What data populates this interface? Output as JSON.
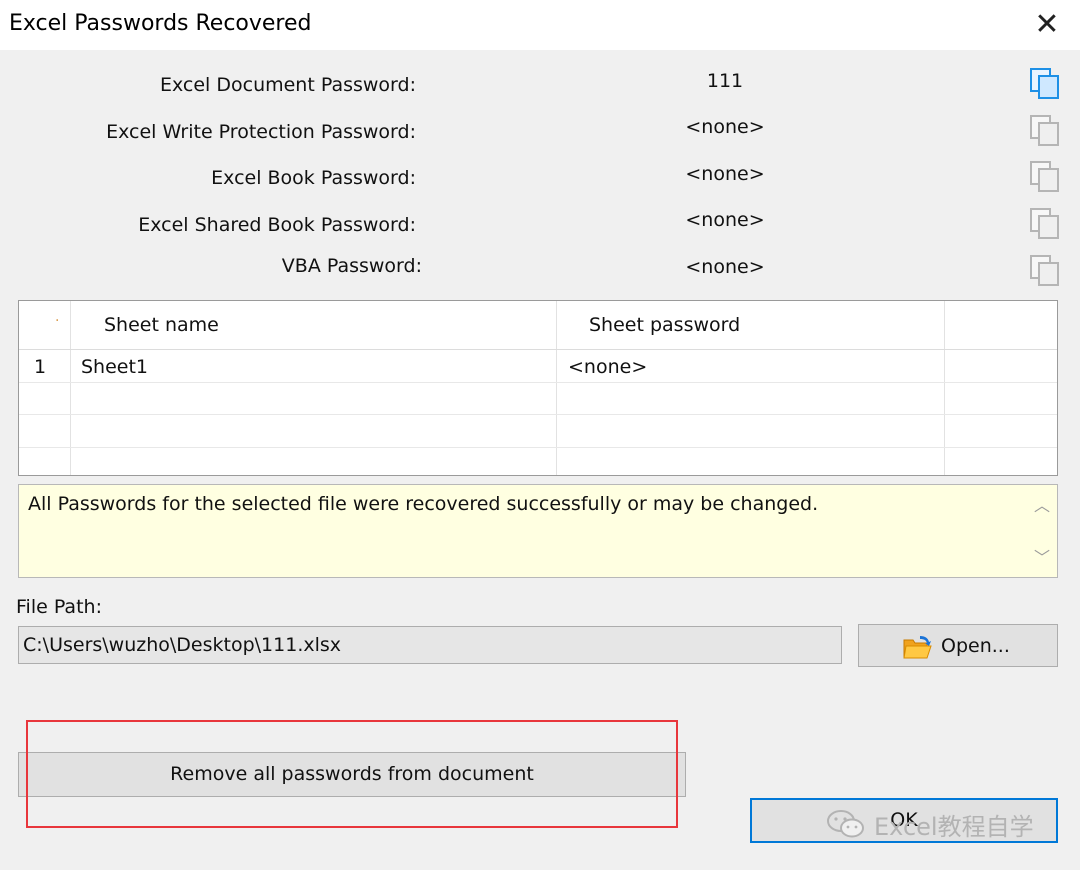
{
  "window": {
    "title": "Excel Passwords Recovered",
    "close_glyph": "✕"
  },
  "passwords": [
    {
      "label": "Excel Document Password:",
      "value": "111",
      "copy_icon_active": true
    },
    {
      "label": "Excel Write Protection Password:",
      "value": "<none>",
      "copy_icon_active": false
    },
    {
      "label": "Excel Book Password:",
      "value": "<none>",
      "copy_icon_active": false
    },
    {
      "label": "Excel Shared Book Password:",
      "value": "<none>",
      "copy_icon_active": false
    },
    {
      "label": "VBA Password:",
      "value": "<none>",
      "copy_icon_active": false
    }
  ],
  "sheets": {
    "row_marker": "·",
    "columns": [
      "Sheet name",
      "Sheet password"
    ],
    "rows": [
      {
        "index": "1",
        "name": "Sheet1",
        "password": "<none>"
      }
    ]
  },
  "message": "All Passwords for the selected file were recovered successfully or may be changed.",
  "file": {
    "label": "File Path:",
    "path": "C:\\Users\\wuzho\\Desktop\\111.xlsx",
    "open_label": "Open..."
  },
  "buttons": {
    "remove": "Remove all passwords from document",
    "ok": "OK"
  },
  "watermark": {
    "text": "Excel教程自学",
    "icon": "wechat-icon"
  },
  "colors": {
    "message_bg": "#ffffe1",
    "highlight_box": "#e8363c",
    "ok_border": "#0078d7"
  }
}
